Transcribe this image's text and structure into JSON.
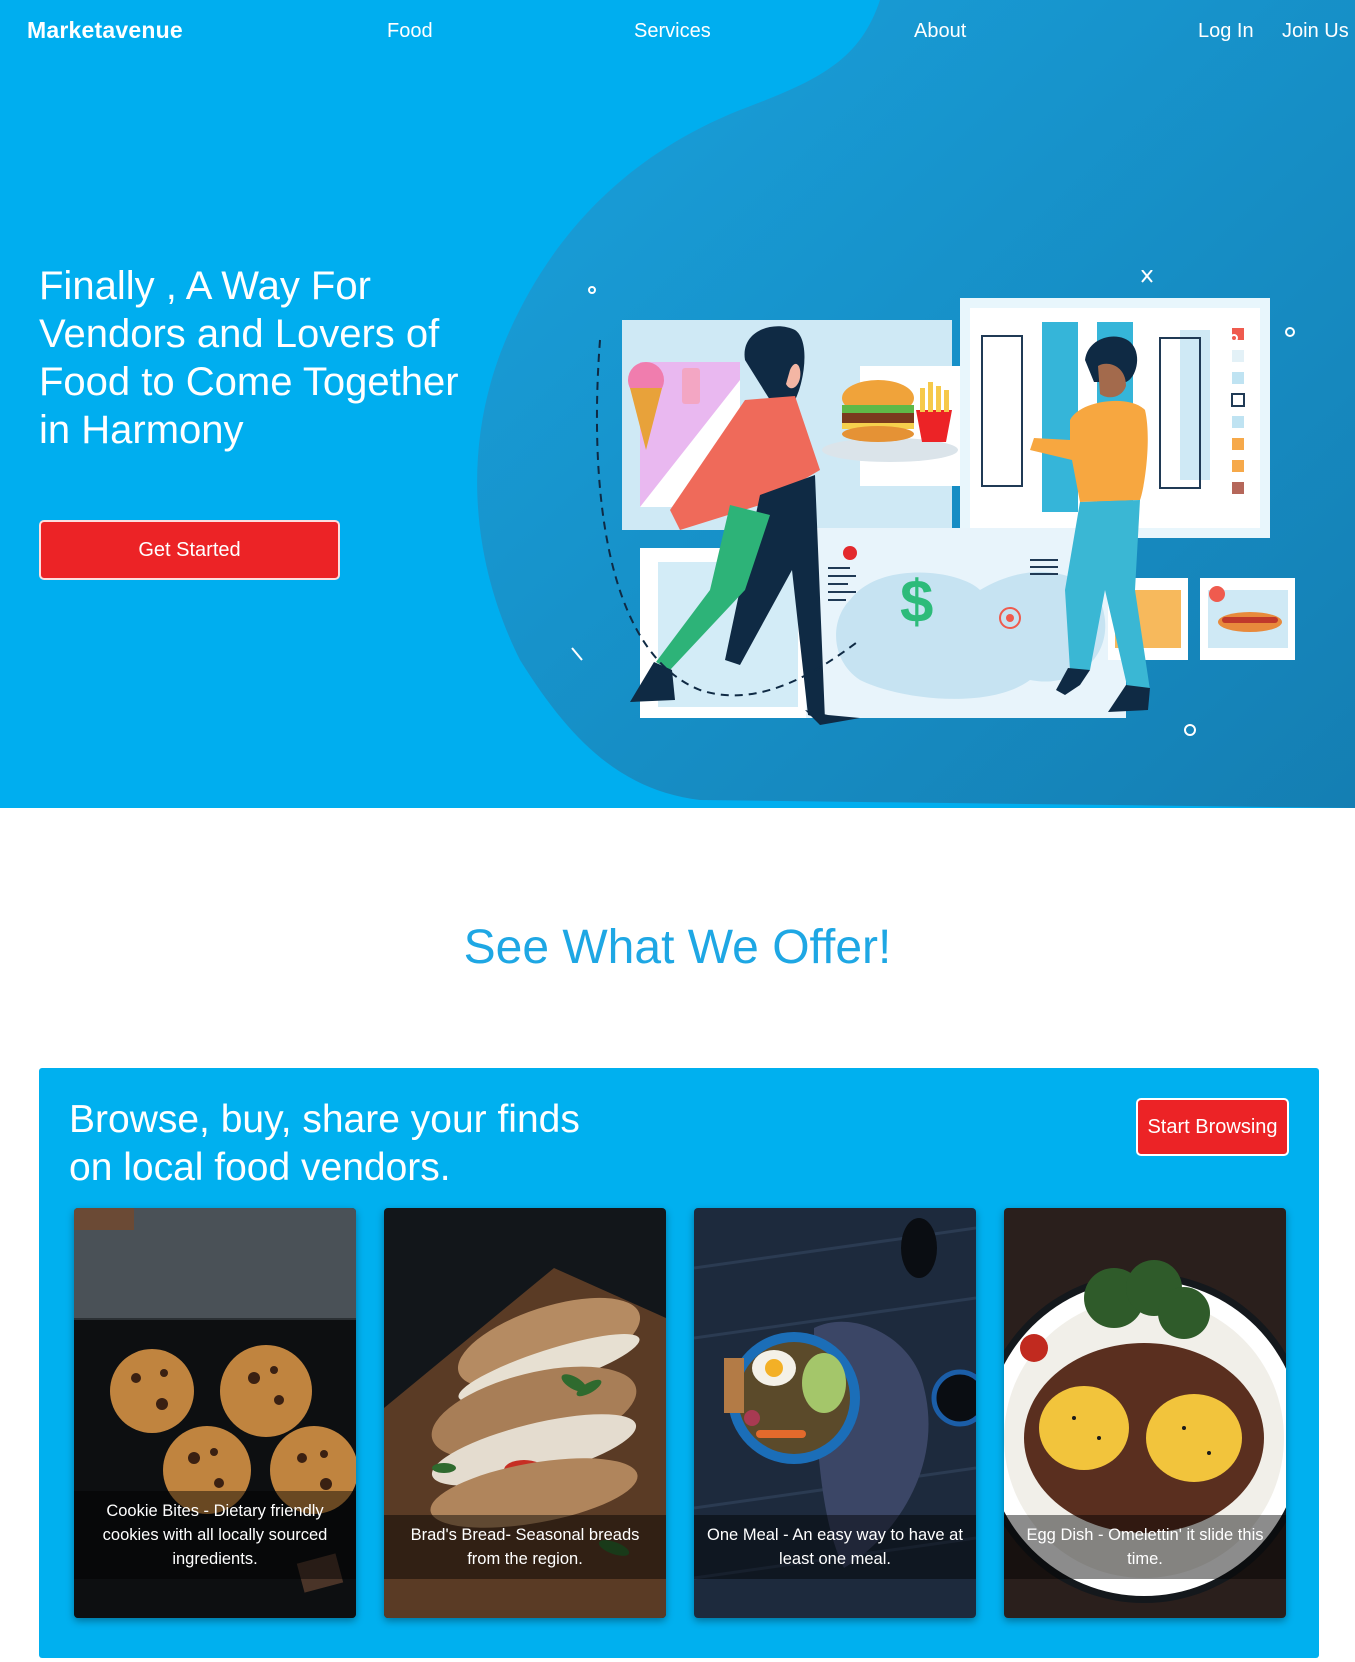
{
  "nav": {
    "brand": "Marketavenue",
    "links": [
      "Food",
      "Services",
      "About",
      "Log In",
      "Join Us"
    ]
  },
  "hero": {
    "title": "Finally , A Way For Vendors and Lovers of Food to Come Together in Harmony",
    "cta": "Get Started"
  },
  "offer": {
    "title": "See What We Offer!",
    "panel_heading": "Browse, buy, share your finds on local food vendors.",
    "browse_button": "Start Browsing",
    "cards": [
      {
        "caption": "Cookie Bites - Dietary friendly cookies with all locally sourced ingredients."
      },
      {
        "caption": "Brad's Bread- Seasonal breads from the region."
      },
      {
        "caption": "One Meal - An easy way to have at least one meal."
      },
      {
        "caption": "Egg Dish - Omelettin' it slide this time."
      }
    ]
  },
  "colors": {
    "primary_blue": "#00aeef",
    "blob_blue": "#1b8fc7",
    "accent_red": "#ec2326",
    "heading_blue": "#1ea7e4"
  },
  "illustration": {
    "icon": "food-market-illustration",
    "price_symbol": "$"
  }
}
